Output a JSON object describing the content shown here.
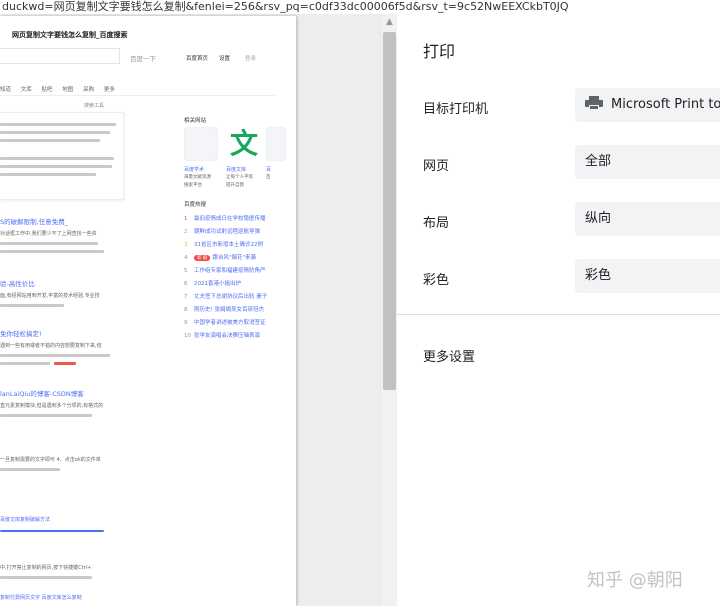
{
  "browser": {
    "url_fragment": "duckwd=网页复制文字要钱怎么复制&fenlei=256&rsv_pq=c0df33dc00006f5d&rsv_t=9c52NwEEXCkbT0JQ"
  },
  "preview": {
    "page_title": "网页复制文字要钱怎么复制_百度搜索",
    "search_button": "百度一下",
    "top_links": [
      "百度首页",
      "设置",
      "登录"
    ],
    "tabs": [
      "知道",
      "文库",
      "贴吧",
      "地图",
      "采购",
      "更多"
    ],
    "tools": "搜索工具",
    "related_title": "相关网站",
    "related_items": [
      {
        "name": "百度学术",
        "desc1": "海量文献资源",
        "desc2": "搜索平台"
      },
      {
        "name": "百度文库",
        "desc1": "让每个人平等",
        "desc2": "提升自我"
      },
      {
        "name": "百",
        "desc1": "百",
        "desc2": ""
      }
    ],
    "wen_glyph": "文",
    "hot_title": "百度热搜",
    "hot_items": [
      {
        "n": "1",
        "t": "最旧疫情成日在学校隐匿传播"
      },
      {
        "n": "2",
        "t": "朝鲜成功试射远程巡航导弹"
      },
      {
        "n": "3",
        "t": "31省区市新增本土确诊22例"
      },
      {
        "n": "4",
        "t": "跟台风\"烟花\"来袭",
        "badge": "新·剧"
      },
      {
        "n": "5",
        "t": "工作组专家和福建疫情防角严"
      },
      {
        "n": "6",
        "t": "2021香港小姐出炉"
      },
      {
        "n": "7",
        "t": "丈夫签下总谢协议后出轨 妻子"
      },
      {
        "n": "8",
        "t": "刚历史! 张娟娟吴女百穿冠杰"
      },
      {
        "n": "9",
        "t": "中国学者讲述被美方取消签证"
      },
      {
        "n": "10",
        "t": "张学友演唱会决赛压轴表演"
      }
    ],
    "results": [
      {
        "title": "S的破解限制,任意免费_",
        "snippet": "对话框工作中,我们要少不了上网查找一些资"
      },
      {
        "title": "验-高性价比",
        "snippet": "面,有经网站用到开发,丰富的技术经验,专业技"
      },
      {
        "title": "免你轻松搞定!",
        "snippet": "遇到一些有用或者不错的内容想要复制下来,结"
      },
      {
        "title": "lanLaiQiu的博客-CSDN博客",
        "snippet": "直元素复制模块,但是遇到多个分项的,有格式的"
      },
      {
        "title": "",
        "snippet": "一旦复制需要的文字即可 4、点击ok的文件单"
      },
      {
        "title": "",
        "snippet": "百度文库复制破解方法"
      },
      {
        "title": "",
        "snippet": "中,打开禁止复制的网页,按下快捷键Ctrl+"
      },
      {
        "title": "",
        "snippet": "复制付费网页文字   百度文库怎么复制"
      }
    ]
  },
  "panel": {
    "title": "打印",
    "rows": [
      {
        "label": "目标打印机",
        "value": "Microsoft Print to PDF",
        "icon": "printer-icon"
      },
      {
        "label": "网页",
        "value": "全部"
      },
      {
        "label": "布局",
        "value": "纵向"
      },
      {
        "label": "彩色",
        "value": "彩色"
      }
    ],
    "more_settings": "更多设置",
    "watermark": "知乎 @朝阳"
  },
  "colors": {
    "link": "#4e6ef2",
    "panel_field": "#f1f3f4",
    "preview_bg": "#ededed"
  }
}
